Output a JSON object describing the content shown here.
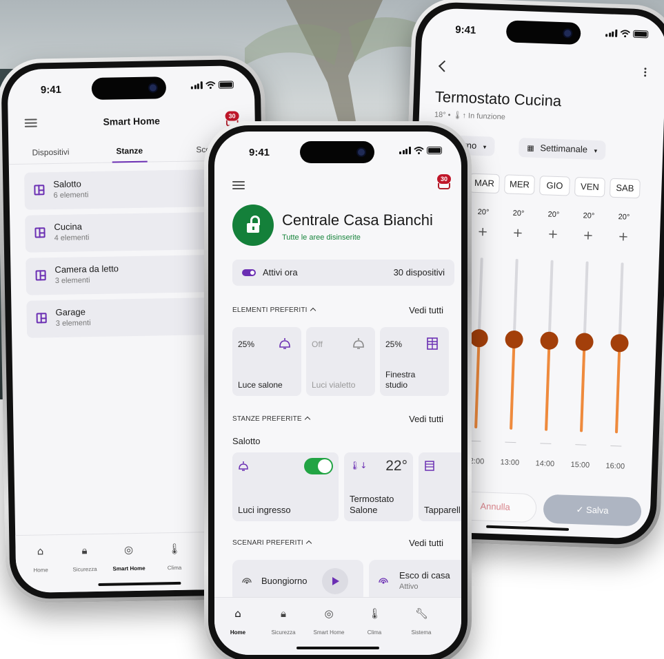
{
  "colors": {
    "accent": "#6b2fb3",
    "ok_green": "#14803a",
    "toggle_green": "#22a444",
    "thermo_fill": "#ef8a3c",
    "thermo_knob": "#a33f0a",
    "badge_red": "#c0172a"
  },
  "status": {
    "time": "9:41"
  },
  "phone_rooms": {
    "header": {
      "title": "Smart Home",
      "badge": "30"
    },
    "tabs": [
      {
        "label": "Dispositivi"
      },
      {
        "label": "Stanze",
        "active": true
      },
      {
        "label": "Sce"
      }
    ],
    "rooms": [
      {
        "name": "Salotto",
        "count": "6 elementi",
        "icon": "room-layout-icon"
      },
      {
        "name": "Cucina",
        "count": "4 elementi",
        "icon": "room-layout-icon"
      },
      {
        "name": "Camera da letto",
        "count": "3 elementi",
        "icon": "room-layout-icon"
      },
      {
        "name": "Garage",
        "count": "3 elementi",
        "icon": "room-layout-icon"
      }
    ],
    "nav": [
      {
        "label": "Home",
        "icon": "home-icon"
      },
      {
        "label": "Sicurezza",
        "icon": "lock-icon"
      },
      {
        "label": "Smart Home",
        "icon": "smart-home-icon",
        "active": true
      },
      {
        "label": "Clima",
        "icon": "thermometer-icon"
      }
    ]
  },
  "phone_hub": {
    "header": {
      "badge": "30"
    },
    "title": "Centrale Casa Bianchi",
    "subtitle": "Tutte le aree disinserite",
    "active_bar": {
      "label": "Attivi ora",
      "count": "30 dispositivi"
    },
    "favorites": {
      "heading": "ELEMENTI PREFERITI",
      "see_all": "Vedi tutti",
      "items": [
        {
          "value": "25%",
          "name": "Luce salone",
          "icon": "ceiling-lamp-icon",
          "on": true
        },
        {
          "value": "Off",
          "name": "Luci vialetto",
          "icon": "ceiling-lamp-icon",
          "on": false
        },
        {
          "value": "25%",
          "name": "Finestra studio",
          "icon": "window-shutter-icon",
          "on": true
        }
      ]
    },
    "fav_rooms": {
      "heading": "STANZE PREFERITE",
      "see_all": "Vedi tutti",
      "room": "Salotto",
      "items": [
        {
          "name": "Luci ingresso",
          "icon": "lamp-icon",
          "toggle": true
        },
        {
          "name": "Termostato Salone",
          "value": "22°",
          "icon": "thermostat-icon"
        },
        {
          "name": "Tapparell",
          "icon": "shutter-icon"
        }
      ]
    },
    "scenarios": {
      "heading": "SCENARI PREFERITI",
      "see_all": "Vedi tutti",
      "items": [
        {
          "name": "Buongiorno",
          "icon": "scenario-icon"
        },
        {
          "name": "Esco di casa",
          "sub": "Attivo",
          "icon": "scenario-icon"
        }
      ]
    },
    "nav": [
      {
        "label": "Home",
        "icon": "home-icon",
        "active": true
      },
      {
        "label": "Sicurezza",
        "icon": "lock-icon"
      },
      {
        "label": "Smart Home",
        "icon": "smart-home-icon"
      },
      {
        "label": "Clima",
        "icon": "thermometer-icon"
      },
      {
        "label": "Sistema",
        "icon": "wrench-icon"
      }
    ]
  },
  "phone_thermo": {
    "title": "Termostato Cucina",
    "subtitle": "18° • 🌡↑ In funzione",
    "chips": [
      {
        "label": "rno"
      },
      {
        "label": "Settimanale"
      }
    ],
    "days": [
      "MAR",
      "MER",
      "GIO",
      "VEN",
      "SAB"
    ],
    "slots": [
      {
        "temp": "20°",
        "time": "12:00",
        "level": 0.53
      },
      {
        "temp": "20°",
        "time": "13:00",
        "level": 0.53
      },
      {
        "temp": "20°",
        "time": "14:00",
        "level": 0.53
      },
      {
        "temp": "20°",
        "time": "15:00",
        "level": 0.53
      },
      {
        "temp": "20°",
        "time": "16:00",
        "level": 0.53
      }
    ],
    "buttons": {
      "cancel": "Annulla",
      "save": "Salva"
    }
  }
}
